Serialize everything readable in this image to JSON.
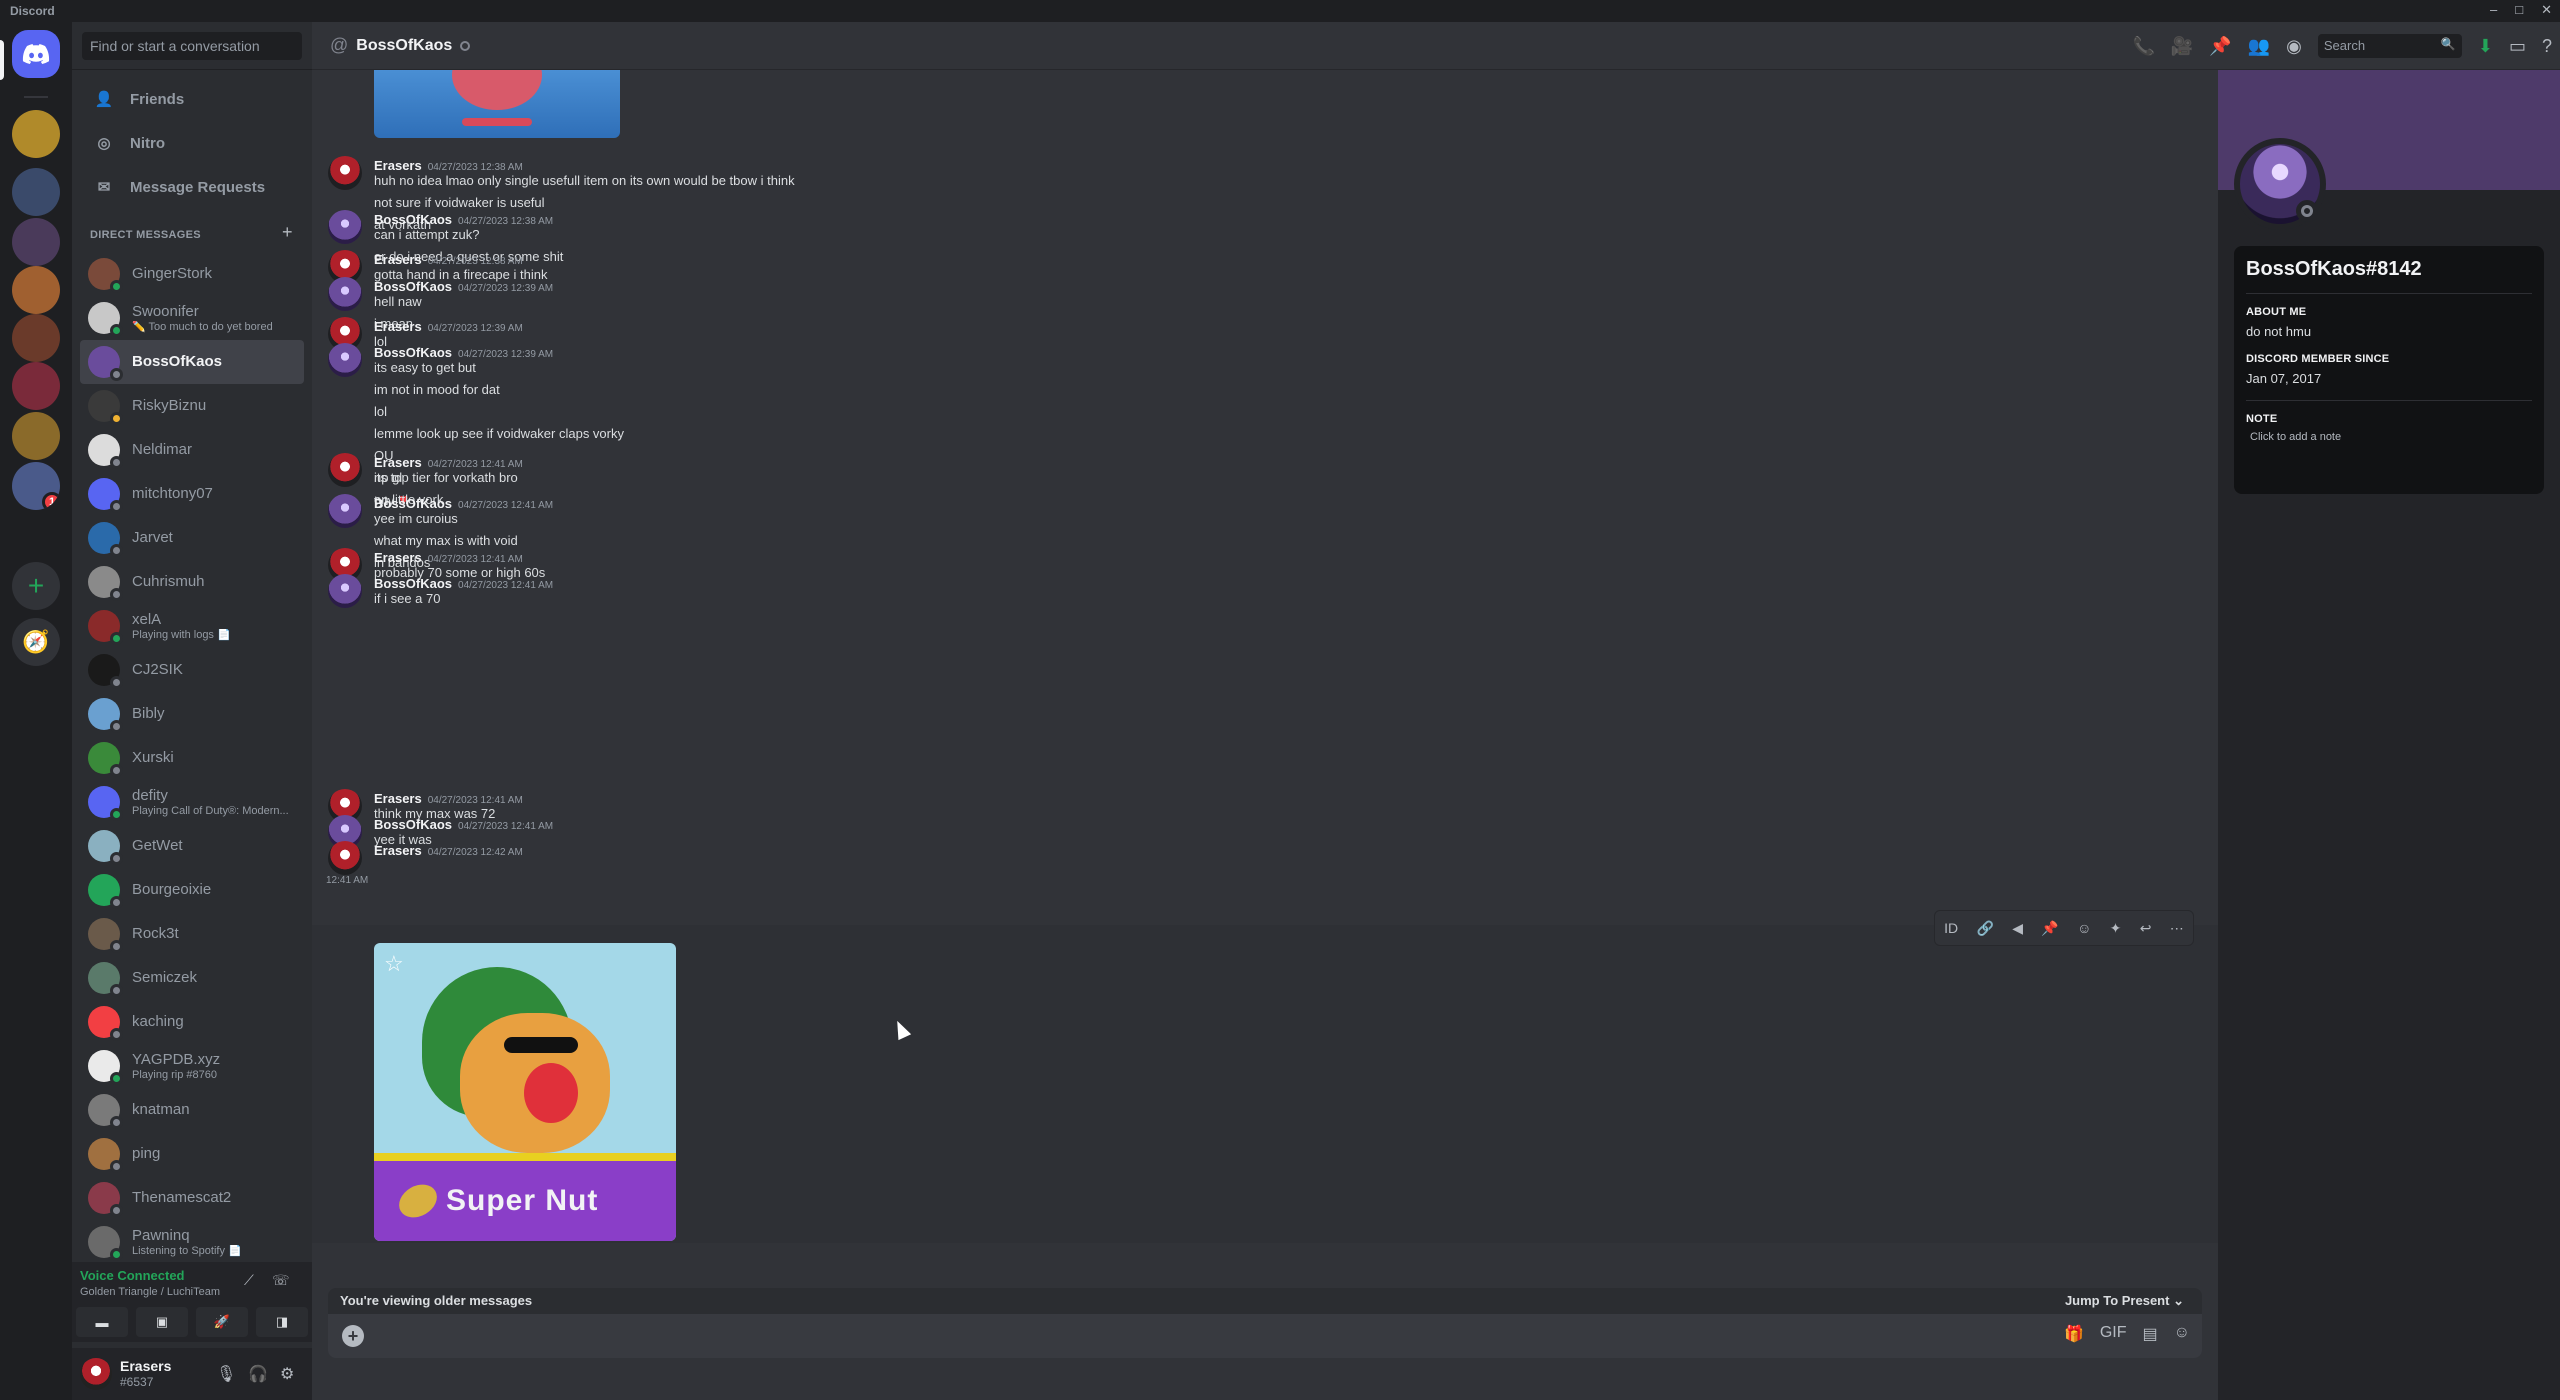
{
  "app": {
    "title": "Discord",
    "winctl": [
      "–",
      "□",
      "✕"
    ]
  },
  "servers": [
    {
      "name": "home",
      "color": "#5865f2"
    },
    {
      "name": "server-1",
      "color": "#b08a2a"
    },
    {
      "name": "server-2",
      "color": "#3a4a6a"
    },
    {
      "name": "server-3",
      "color": "#4a3a5a"
    },
    {
      "name": "server-4",
      "color": "#a06030"
    },
    {
      "name": "server-5",
      "color": "#6a3a2a"
    },
    {
      "name": "server-6",
      "color": "#7a2a3a"
    },
    {
      "name": "server-7",
      "color": "#8a6a2a"
    },
    {
      "name": "server-8",
      "color": "#4a5a8a",
      "badge": "1"
    }
  ],
  "sidebar": {
    "search_placeholder": "Find or start a conversation",
    "nav": [
      {
        "label": "Friends",
        "icon": "👤"
      },
      {
        "label": "Nitro",
        "icon": "◎"
      },
      {
        "label": "Message Requests",
        "icon": "✉"
      }
    ],
    "dm_header": "DIRECT MESSAGES",
    "dm_add": "+",
    "dms": [
      {
        "name": "GingerStork",
        "sub": "",
        "status": "on",
        "color": "#7a4a3a"
      },
      {
        "name": "Swoonifer",
        "sub": "✏️ Too much to do yet bored",
        "status": "on",
        "color": "#c8c8c8"
      },
      {
        "name": "BossOfKaos",
        "sub": "",
        "status": "off",
        "color": "#6a4c9c",
        "active": true
      },
      {
        "name": "RiskyBiznu",
        "sub": "",
        "status": "idle",
        "color": "#3a3a3a"
      },
      {
        "name": "Neldimar",
        "sub": "",
        "status": "off",
        "color": "#dcdcdc"
      },
      {
        "name": "mitchtony07",
        "sub": "",
        "status": "off",
        "color": "#5865f2"
      },
      {
        "name": "Jarvet",
        "sub": "",
        "status": "off",
        "color": "#2a6aaa"
      },
      {
        "name": "Cuhrismuh",
        "sub": "",
        "status": "off",
        "color": "#8a8a8a"
      },
      {
        "name": "xelA",
        "sub": "Playing with logs 📄",
        "status": "on",
        "color": "#8a2a2a"
      },
      {
        "name": "CJ2SIK",
        "sub": "",
        "status": "off",
        "color": "#1a1a1a"
      },
      {
        "name": "Bibly",
        "sub": "",
        "status": "off",
        "color": "#6aa0d0"
      },
      {
        "name": "Xurski",
        "sub": "",
        "status": "off",
        "color": "#3a8a3a"
      },
      {
        "name": "defity",
        "sub": "Playing Call of Duty®: Modern...",
        "status": "on",
        "color": "#5865f2"
      },
      {
        "name": "GetWet",
        "sub": "",
        "status": "off",
        "color": "#8ab0c0"
      },
      {
        "name": "Bourgeoixie",
        "sub": "",
        "status": "off",
        "color": "#23a559"
      },
      {
        "name": "Rock3t",
        "sub": "",
        "status": "off",
        "color": "#6a5a4a"
      },
      {
        "name": "Semiczek",
        "sub": "",
        "status": "off",
        "color": "#5a7a6a"
      },
      {
        "name": "kaching",
        "sub": "",
        "status": "off",
        "color": "#f23f43"
      },
      {
        "name": "YAGPDB.xyz",
        "sub": "Playing rip #8760",
        "status": "on",
        "color": "#eaeaea"
      },
      {
        "name": "knatman",
        "sub": "",
        "status": "off",
        "color": "#7a7a7a"
      },
      {
        "name": "ping",
        "sub": "",
        "status": "off",
        "color": "#a07040"
      },
      {
        "name": "Thenamescat2",
        "sub": "",
        "status": "off",
        "color": "#8a3a4a"
      },
      {
        "name": "Pawninq",
        "sub": "Listening to Spotify 📄",
        "status": "on",
        "color": "#6a6a6a"
      }
    ],
    "voice": {
      "status": "Voice Connected",
      "channel": "Golden Triangle / LuchiTeam"
    },
    "user": {
      "name": "Erasers",
      "tag": "#6537"
    }
  },
  "header": {
    "name": "BossOfKaos",
    "search_placeholder": "Search"
  },
  "messages": [
    {
      "author": "Erasers",
      "time": "04/27/2023 12:38 AM",
      "lines": [
        "huh no idea lmao only single usefull item on its own would be tbow i think",
        "not sure if voidwaker is useful",
        "at vorkath"
      ]
    },
    {
      "author": "BossOfKaos",
      "time": "04/27/2023 12:38 AM",
      "lines": [
        "can i attempt zuk?",
        "or do i need a quest or some shit"
      ]
    },
    {
      "author": "Erasers",
      "time": "04/27/2023 12:38 AM",
      "lines": [
        "gotta hand in a firecape i think"
      ]
    },
    {
      "author": "BossOfKaos",
      "time": "04/27/2023 12:39 AM",
      "lines": [
        "hell naw",
        "i  mean"
      ]
    },
    {
      "author": "Erasers",
      "time": "04/27/2023 12:39 AM",
      "lines": [
        "lol"
      ]
    },
    {
      "author": "BossOfKaos",
      "time": "04/27/2023 12:39 AM",
      "lines": [
        "its easy to get but",
        "im not in mood for dat",
        "lol",
        "lemme look up see if voidwaker claps vorky",
        "OU",
        "its top tier for vorkath bro",
        "tyty"
      ]
    },
    {
      "author": "Erasers",
      "time": "04/27/2023 12:41 AM",
      "lines": [
        "np gl",
        "on little vork"
      ]
    },
    {
      "author": "BossOfKaos",
      "time": "04/27/2023 12:41 AM",
      "lines": [
        "yee im curoius",
        "what my max is with void",
        "in bandos"
      ]
    },
    {
      "author": "Erasers",
      "time": "04/27/2023 12:41 AM",
      "lines": [
        "probably 70 some or high 60s"
      ]
    },
    {
      "author": "BossOfKaos",
      "time": "04/27/2023 12:41 AM",
      "lines": [
        "if i see a 70"
      ]
    },
    {
      "author": "Erasers",
      "time": "04/27/2023 12:41 AM",
      "lines": [
        "think my max was 72"
      ]
    },
    {
      "author": "BossOfKaos",
      "time": "04/27/2023 12:41 AM",
      "lines": [
        "yee it was"
      ]
    },
    {
      "author": "Erasers",
      "time": "04/27/2023 12:42 AM",
      "lines": []
    }
  ],
  "image_timestamp": "12:41 AM",
  "image_caption": "Super  Nut",
  "older_notice": "You're viewing older messages",
  "jump_label": "Jump To Present",
  "profile": {
    "name": "BossOfKaos#8142",
    "about_label": "ABOUT ME",
    "about": "do not hmu",
    "since_label": "DISCORD MEMBER SINCE",
    "since": "Jan 07, 2017",
    "note_label": "NOTE",
    "note_placeholder": "Click to add a note"
  }
}
